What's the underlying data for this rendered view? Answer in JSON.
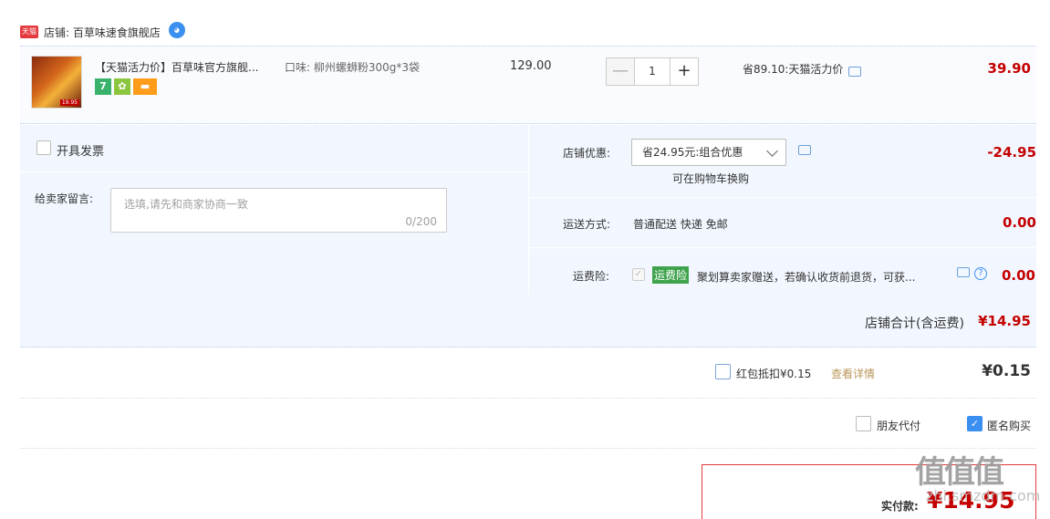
{
  "shop": {
    "badge": "天猫",
    "label": "店铺: 百草味速食旗舰店"
  },
  "item": {
    "title": "【天猫活力价】百草味官方旗舰...",
    "spec": "口味: 柳州螺蛳粉300g*3袋",
    "thumb_price": "19.95",
    "unit_price": "129.00",
    "quantity": "1",
    "qty_minus": "—",
    "qty_plus": "+",
    "discount": "省89.10:天猫活力价",
    "total": "39.90"
  },
  "invoice": {
    "label": "开具发票"
  },
  "memo": {
    "label": "给卖家留言:",
    "placeholder": "选填,请先和商家协商一致",
    "count": "0/200"
  },
  "shop_discount": {
    "label": "店铺优惠:",
    "selected": "省24.95元:组合优惠",
    "hint": "可在购物车换购",
    "amount": "-24.95"
  },
  "shipping": {
    "label": "运送方式:",
    "method": "普通配送 快递 免邮",
    "amount": "0.00"
  },
  "insurance": {
    "label": "运费险:",
    "tag": "运费险",
    "text": "聚划算卖家赠送，若确认收货前退货，可获...",
    "help": "?",
    "amount": "0.00"
  },
  "subtotal": {
    "label": "店铺合计(含运费)",
    "value": "¥14.95"
  },
  "redpack": {
    "label": "红包抵扣¥0.15",
    "link": "查看详情",
    "value": "¥0.15"
  },
  "pay_options": {
    "friend_label": "朋友代付",
    "anonymous_label": "匿名购买",
    "anonymous_checked": true
  },
  "payment": {
    "label": "实付款:",
    "value": "¥14.95"
  },
  "watermark": {
    "icon": "值值值",
    "text": "zhi.smzdm.com"
  },
  "colors": {
    "price_red": "#c40000",
    "row_blue_bg": "#f2f7ff",
    "accent_blue": "#3b8ff0",
    "insurance_green": "#3fa34d"
  }
}
